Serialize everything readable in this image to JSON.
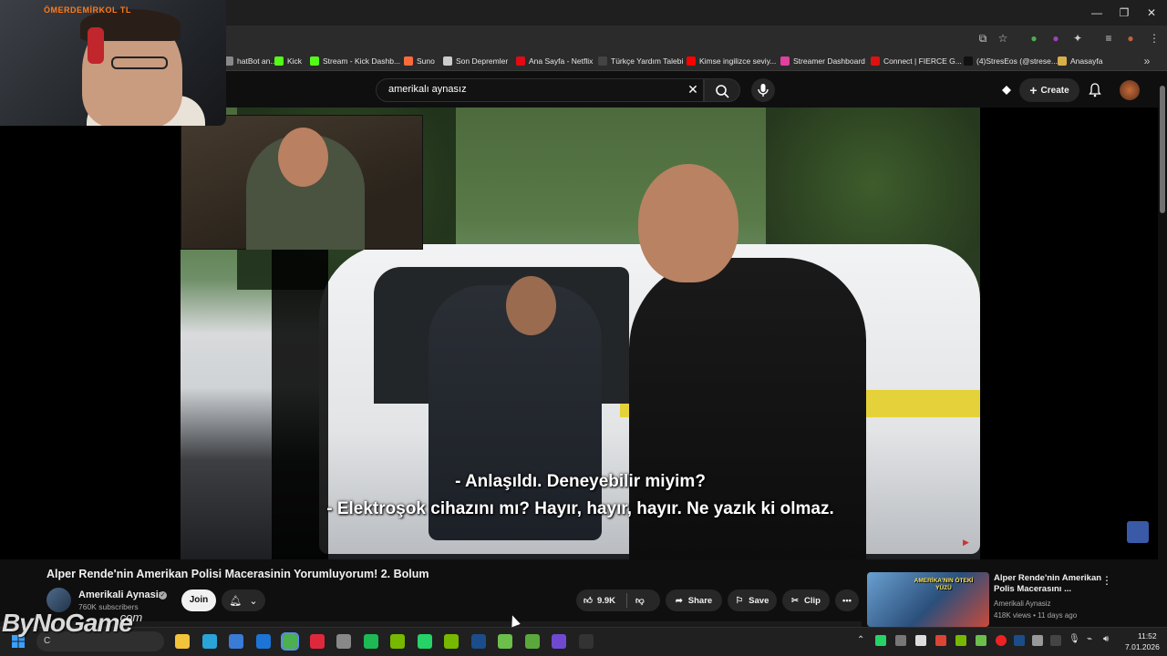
{
  "webcam": {
    "label": "ÖMERDEMİRKOL TL"
  },
  "window": {
    "minimize": "—",
    "maximize": "❐",
    "close": "✕"
  },
  "bookmarks": [
    {
      "label": "hatBot an...",
      "color": "#888888"
    },
    {
      "label": "Kick",
      "color": "#53fc18"
    },
    {
      "label": "Stream - Kick Dashb...",
      "color": "#53fc18"
    },
    {
      "label": "Suno",
      "color": "#ff6a3d"
    },
    {
      "label": "Son Depremler",
      "color": "#cccccc"
    },
    {
      "label": "Ana Sayfa - Netflix",
      "color": "#e50914"
    },
    {
      "label": "Türkçe Yardım Talebi",
      "color": "#444444"
    },
    {
      "label": "Kimse ingilizce seviy...",
      "color": "#ff0000"
    },
    {
      "label": "Streamer Dashboard",
      "color": "#e040a0"
    },
    {
      "label": "Connect | FIERCE G...",
      "color": "#d11"
    },
    {
      "label": "(4)StresEos (@strese...",
      "color": "#111111"
    },
    {
      "label": "Anasayfa",
      "color": "#d8b04a"
    }
  ],
  "search": {
    "query": "amerikalı aynasız"
  },
  "header": {
    "create_label": "Create"
  },
  "subtitles": {
    "line1": "- Anlaşıldı. Deneyebilir miyim?",
    "line2": "- Elektroşok cihazını mı? Hayır, hayır, hayır. Ne yazık ki olmaz."
  },
  "video": {
    "title": "Alper Rende'nin Amerikan Polisi Macerasinin Yorumluyorum! 2. Bolum",
    "channel": "Amerikali Aynasiz",
    "subscribers": "760K subscribers",
    "join_label": "Join",
    "likes": "9.9K",
    "share_label": "Share",
    "save_label": "Save",
    "clip_label": "Clip"
  },
  "related": {
    "thumb_text": "AMERİKA'NIN ÖTEKİ YÜZÜ",
    "title": "Alper Rende'nin Amerikan Polis Macerasını ...",
    "channel": "Amerikali Aynasiz",
    "meta": "418K views • 11 days ago"
  },
  "taskbar": {
    "search_placeholder": "C",
    "watermark": "ByNoGame",
    "watermark_suffix": ".com",
    "time": "11:52",
    "date": "7.01.2026"
  },
  "icons": {
    "taskbar_apps": [
      {
        "name": "file-explorer-icon",
        "color": "#f3c33c"
      },
      {
        "name": "edge-icon",
        "color": "#2aa3d8"
      },
      {
        "name": "store-icon",
        "color": "#3a7bd5"
      },
      {
        "name": "outlook-icon",
        "color": "#1c74d4"
      },
      {
        "name": "chrome-icon",
        "color": "#4caf50"
      },
      {
        "name": "opera-icon",
        "color": "#e0283c"
      },
      {
        "name": "app-icon",
        "color": "#888888"
      },
      {
        "name": "spotify-icon",
        "color": "#1db954"
      },
      {
        "name": "nvidia-icon",
        "color": "#76b900"
      },
      {
        "name": "whatsapp-icon",
        "color": "#25d366"
      },
      {
        "name": "geforce-icon",
        "color": "#76b900"
      },
      {
        "name": "steam-icon",
        "color": "#1b4d8a"
      },
      {
        "name": "xbox-icon",
        "color": "#6bbf4a"
      },
      {
        "name": "minecraft-icon",
        "color": "#5aa83c"
      },
      {
        "name": "obs-icon",
        "color": "#6f4ad1"
      },
      {
        "name": "epic-icon",
        "color": "#333333"
      }
    ]
  }
}
